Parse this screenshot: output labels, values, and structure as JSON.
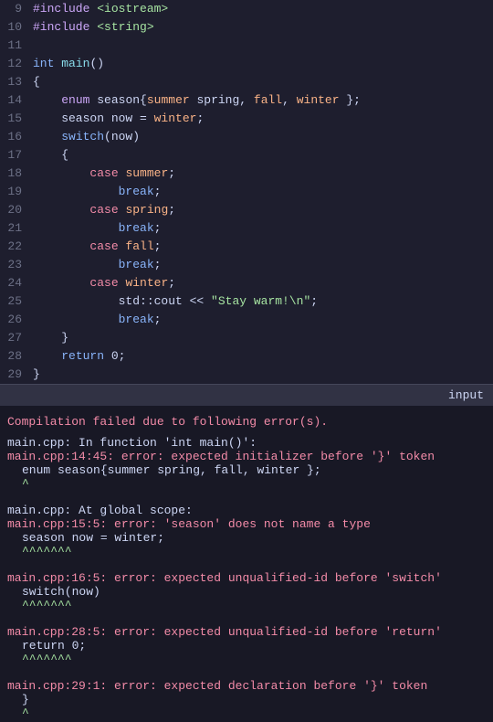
{
  "editor": {
    "lines": [
      {
        "num": "9",
        "tokens": [
          {
            "t": "#include <iostream>",
            "c": "kw2"
          }
        ]
      },
      {
        "num": "10",
        "tokens": [
          {
            "t": "#include <string>",
            "c": "kw2"
          }
        ]
      },
      {
        "num": "11",
        "tokens": []
      },
      {
        "num": "12",
        "tokens": [
          {
            "t": "int",
            "c": "kw"
          },
          {
            "t": " main()",
            "c": "plain"
          }
        ]
      },
      {
        "num": "13",
        "tokens": [
          {
            "t": "{",
            "c": "plain"
          }
        ]
      },
      {
        "num": "14",
        "tokens": [
          {
            "t": "    enum season{summer spring, fall, winter };",
            "c": "line14"
          }
        ]
      },
      {
        "num": "15",
        "tokens": [
          {
            "t": "    season now = winter;",
            "c": "line15"
          }
        ]
      },
      {
        "num": "16",
        "tokens": [
          {
            "t": "    switch(now)",
            "c": "line16"
          }
        ]
      },
      {
        "num": "17",
        "tokens": [
          {
            "t": "    {",
            "c": "plain"
          }
        ]
      },
      {
        "num": "18",
        "tokens": [
          {
            "t": "        case summer;",
            "c": "line18"
          }
        ]
      },
      {
        "num": "19",
        "tokens": [
          {
            "t": "            break;",
            "c": "line19"
          }
        ]
      },
      {
        "num": "20",
        "tokens": [
          {
            "t": "        case spring;",
            "c": "line20"
          }
        ]
      },
      {
        "num": "21",
        "tokens": [
          {
            "t": "            break;",
            "c": "line19"
          }
        ]
      },
      {
        "num": "22",
        "tokens": [
          {
            "t": "        case fall;",
            "c": "line20"
          }
        ]
      },
      {
        "num": "23",
        "tokens": [
          {
            "t": "            break;",
            "c": "line19"
          }
        ]
      },
      {
        "num": "24",
        "tokens": [
          {
            "t": "        case winter;",
            "c": "line20"
          }
        ]
      },
      {
        "num": "25",
        "tokens": [
          {
            "t": "            std::cout << \"Stay warm!\\n\";",
            "c": "line25"
          }
        ]
      },
      {
        "num": "26",
        "tokens": [
          {
            "t": "            break;",
            "c": "line19"
          }
        ]
      },
      {
        "num": "27",
        "tokens": [
          {
            "t": "    }",
            "c": "plain"
          }
        ]
      },
      {
        "num": "28",
        "tokens": [
          {
            "t": "    return 0;",
            "c": "line28"
          }
        ]
      },
      {
        "num": "29",
        "tokens": [
          {
            "t": "}",
            "c": "plain"
          }
        ]
      }
    ]
  },
  "input_bar": {
    "label": "input"
  },
  "output": {
    "compile_fail": "Compilation failed due to following error(s).",
    "errors": [
      {
        "location": "main.cpp: In function 'int main()':",
        "location_colored": false,
        "desc": ""
      },
      {
        "location": "main.cpp:14:45: error: expected initializer before '}' token",
        "location_colored": true,
        "code_line": "    enum season{summer spring, fall, winter };",
        "caret": "                                            ^"
      },
      {
        "location": "main.cpp: At global scope:",
        "location_colored": false
      },
      {
        "location": "main.cpp:15:5: error: 'season' does not name a type",
        "location_colored": true,
        "code_line": "    season now = winter;",
        "caret": "    ^^^^^^^"
      },
      {
        "location": "main.cpp:16:5: error: expected unqualified-id before 'switch'",
        "location_colored": true,
        "code_line": "    switch(now)",
        "caret": "    ^^^^^^^"
      },
      {
        "location": "main.cpp:28:5: error: expected unqualified-id before 'return'",
        "location_colored": true,
        "code_line": "    return 0;",
        "caret": "    ^^^^^^^"
      },
      {
        "location": "main.cpp:29:1: error: expected declaration before '}' token",
        "location_colored": true,
        "code_line": "}",
        "caret": ""
      }
    ]
  }
}
